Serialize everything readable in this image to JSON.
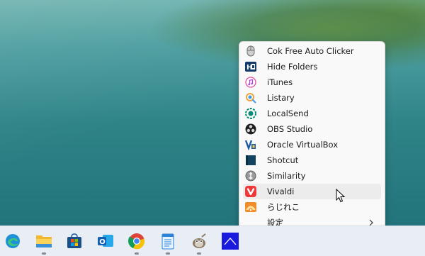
{
  "menu": {
    "items": [
      {
        "label": "Cok Free Auto Clicker",
        "icon": "mouse-icon"
      },
      {
        "label": "Hide Folders",
        "icon": "hide-folders-icon"
      },
      {
        "label": "iTunes",
        "icon": "music-note-icon"
      },
      {
        "label": "Listary",
        "icon": "search-magnifier-icon"
      },
      {
        "label": "LocalSend",
        "icon": "localsend-icon"
      },
      {
        "label": "OBS Studio",
        "icon": "obs-icon"
      },
      {
        "label": "Oracle VirtualBox",
        "icon": "virtualbox-icon"
      },
      {
        "label": "Shotcut",
        "icon": "film-icon"
      },
      {
        "label": "Similarity",
        "icon": "similarity-icon"
      },
      {
        "label": "Vivaldi",
        "icon": "vivaldi-icon"
      },
      {
        "label": "らじれこ",
        "icon": "radio-icon"
      },
      {
        "label": "設定",
        "icon": "none",
        "has_submenu": true
      }
    ],
    "hovered_index": 9
  },
  "taskbar": {
    "apps": [
      {
        "name": "Microsoft Edge",
        "icon": "edge-icon",
        "running": false
      },
      {
        "name": "File Explorer",
        "icon": "folder-icon",
        "running": true
      },
      {
        "name": "Microsoft Store",
        "icon": "store-icon",
        "running": false
      },
      {
        "name": "Outlook",
        "icon": "outlook-icon",
        "running": false
      },
      {
        "name": "Google Chrome",
        "icon": "chrome-icon",
        "running": true
      },
      {
        "name": "Notepad",
        "icon": "notepad-icon",
        "running": true
      },
      {
        "name": "GIMP",
        "icon": "gimp-icon",
        "running": true
      },
      {
        "name": "Launcher",
        "icon": "launcher-icon",
        "running": false
      }
    ]
  },
  "colors": {
    "menu_bg": "#f9f9f9",
    "hover_bg": "#ececec",
    "taskbar_bg": "#e8eef3",
    "vivaldi_red": "#ef3939"
  }
}
